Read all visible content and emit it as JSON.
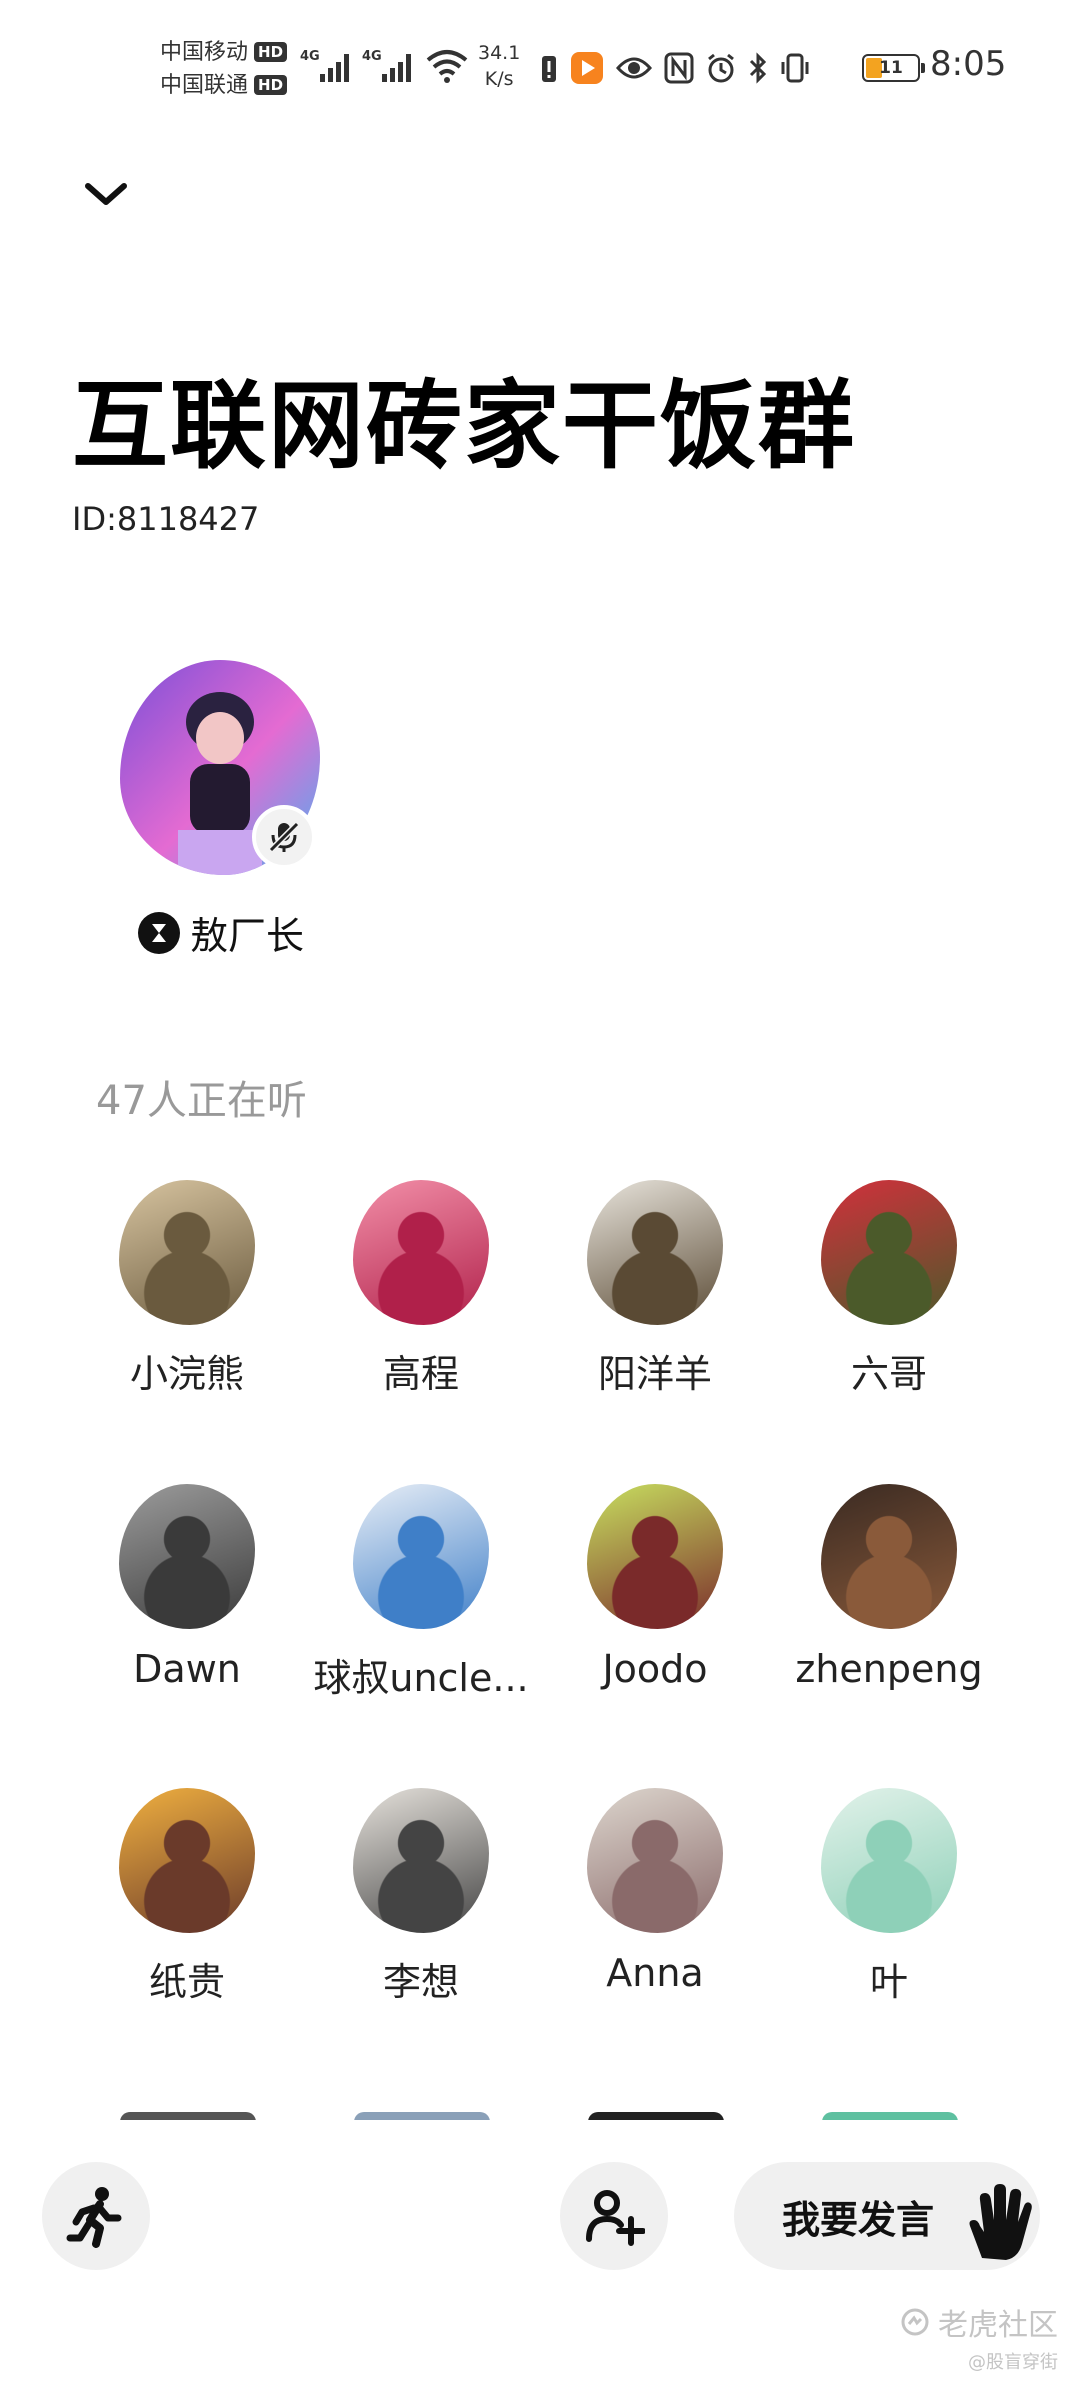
{
  "status_bar": {
    "carrier1": "中国移动",
    "carrier2": "中国联通",
    "hd": "HD",
    "speed_value": "34.1",
    "speed_unit": "K/s",
    "battery": "11",
    "time": "8:05"
  },
  "room": {
    "title": "互联网砖家干饭群",
    "id": "ID:8118427"
  },
  "host": {
    "name": "敖厂长",
    "avatar_colors": [
      "#7b4fd8",
      "#e46bd2",
      "#4ab0f0"
    ]
  },
  "listeners_label": "47人正在听",
  "listeners": [
    {
      "name": "小浣熊",
      "colors": [
        "#6a5a3e",
        "#d7c4a0"
      ]
    },
    {
      "name": "高程",
      "colors": [
        "#b0204a",
        "#f28fa8"
      ]
    },
    {
      "name": "阳洋羊",
      "colors": [
        "#5a4a34",
        "#e8e4dc"
      ]
    },
    {
      "name": "六哥",
      "colors": [
        "#4b5a2a",
        "#d2303c"
      ]
    },
    {
      "name": "Dawn",
      "colors": [
        "#3a3a3a",
        "#9c9c9c"
      ]
    },
    {
      "name": "球叔uncle...",
      "colors": [
        "#3f7fc8",
        "#e8eef6"
      ]
    },
    {
      "name": "Joodo",
      "colors": [
        "#7a2a2a",
        "#c8e060"
      ]
    },
    {
      "name": "zhenpeng",
      "colors": [
        "#8a5a3a",
        "#3a2a22"
      ]
    },
    {
      "name": "纸贵",
      "colors": [
        "#6a3a2a",
        "#f0b040"
      ]
    },
    {
      "name": "李想",
      "colors": [
        "#444444",
        "#e6e2dc"
      ]
    },
    {
      "name": "Anna",
      "colors": [
        "#8a6a6a",
        "#ddd6ce"
      ]
    },
    {
      "name": "叶",
      "colors": [
        "#8ed0b8",
        "#e2f2ea"
      ]
    }
  ],
  "bottom_bar": {
    "speak_label": "我要发言"
  },
  "watermark": {
    "line1": "老虎社区",
    "line2": "@股盲穿街"
  }
}
